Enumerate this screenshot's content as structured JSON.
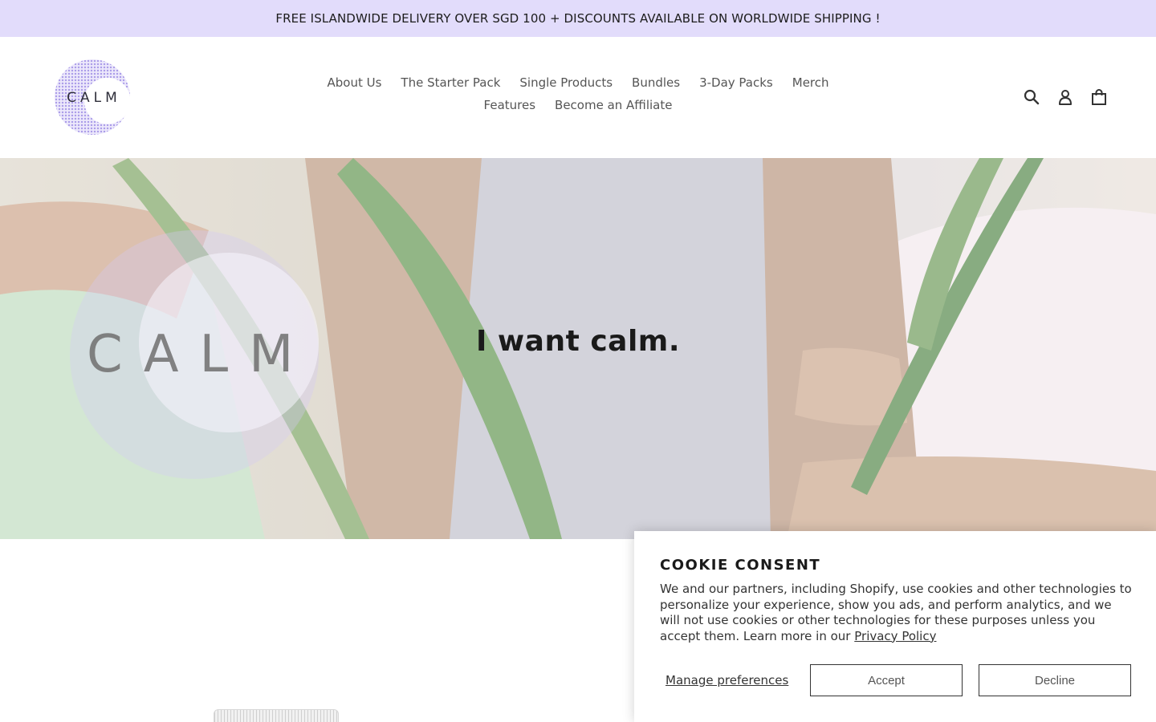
{
  "announcement": {
    "text": "FREE ISLANDWIDE DELIVERY OVER SGD 100 + DISCOUNTS AVAILABLE ON WORLDWIDE SHIPPING !"
  },
  "header": {
    "logo_text": "CALM",
    "nav": [
      "About Us",
      "The Starter Pack",
      "Single Products",
      "Bundles",
      "3-Day Packs",
      "Merch",
      "Features",
      "Become an Affiliate"
    ],
    "icons": [
      "search-icon",
      "account-icon",
      "cart-icon"
    ]
  },
  "hero": {
    "title": "I want calm.",
    "logo_text": "CALM"
  },
  "cookie": {
    "heading": "COOKIE CONSENT",
    "body": "We and our partners, including Shopify, use cookies and other technologies to personalize your experience, show you ads, and perform analytics, and we will not use cookies or other technologies for these purposes unless you accept them. Learn more in our",
    "policy_link": "Privacy Policy",
    "manage_label": "Manage preferences",
    "accept_label": "Accept",
    "decline_label": "Decline"
  },
  "colors": {
    "announcement_bg": "#e2dcfb",
    "accent_lavender": "#a99be8"
  }
}
